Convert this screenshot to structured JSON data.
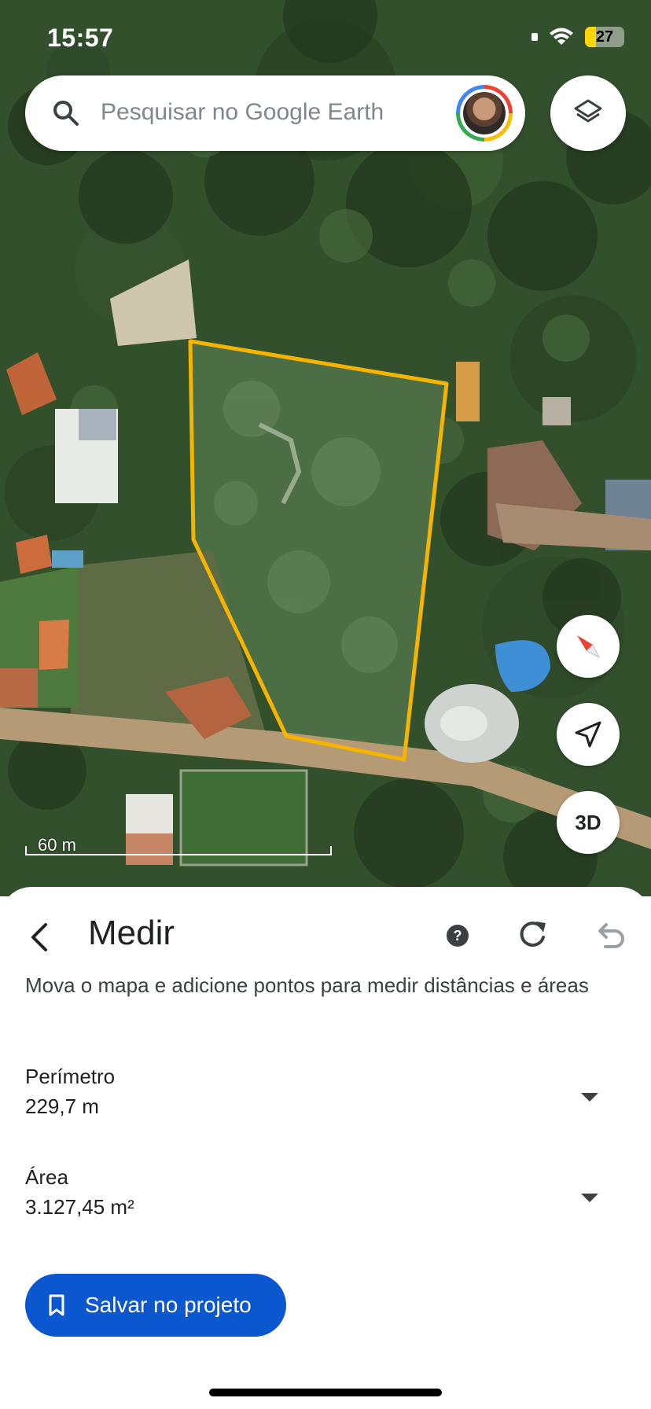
{
  "status_bar": {
    "time": "15:57",
    "battery_level": "27",
    "battery_fraction": 0.27,
    "battery_color": "#ffd60a"
  },
  "search": {
    "placeholder": "Pesquisar no Google Earth",
    "search_icon": "search-icon",
    "avatar_icon": "user-avatar"
  },
  "map": {
    "scale_label": "60 m",
    "polygon_color": "#f4b400",
    "buttons": {
      "layers": "layers-icon",
      "compass": "compass-icon",
      "my_location": "navigation-arrow-icon",
      "three_d_label": "3D"
    }
  },
  "sheet": {
    "title": "Medir",
    "description": "Mova o mapa e adicione pontos para medir distâncias e áreas",
    "icons": {
      "back": "back-arrow-icon",
      "help": "help-icon",
      "refresh": "refresh-icon",
      "undo": "undo-icon"
    },
    "metrics": [
      {
        "label": "Perímetro",
        "value": "229,7 m"
      },
      {
        "label": "Área",
        "value": "3.127,45 m²"
      }
    ],
    "save_button": {
      "label": "Salvar no projeto",
      "icon": "bookmark-icon",
      "color": "#0b57d0"
    }
  }
}
